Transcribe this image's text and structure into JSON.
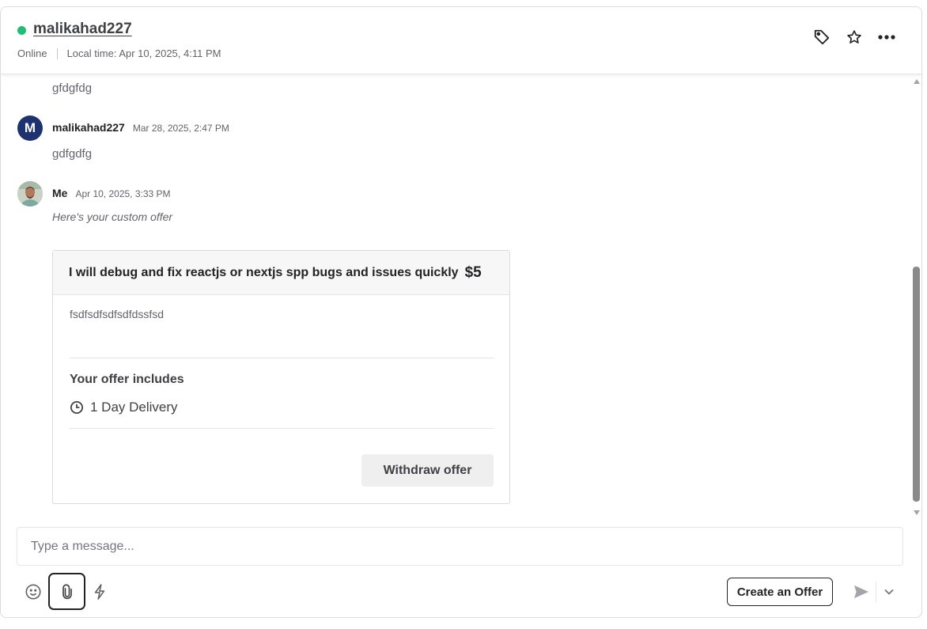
{
  "header": {
    "username": "malikahad227",
    "status": "Online",
    "local_time": "Local time: Apr 10, 2025, 4:11 PM",
    "icons": [
      "tag-icon",
      "star-icon",
      "more-icon"
    ]
  },
  "messages": [
    {
      "text": "gfdgfdg"
    },
    {
      "sender": "malikahad227",
      "avatar_letter": "M",
      "time": "Mar 28, 2025, 2:47 PM",
      "text": "gdfgdfg"
    },
    {
      "sender": "Me",
      "time": "Apr 10, 2025, 3:33 PM",
      "text": "Here's your custom offer"
    }
  ],
  "offer": {
    "title": "I will debug and fix reactjs or nextjs spp bugs and issues quickly",
    "price": "$5",
    "description": "fsdfsdfsdfsdfdssfsd",
    "includes_label": "Your offer includes",
    "delivery": "1 Day Delivery",
    "withdraw_label": "Withdraw offer"
  },
  "composer": {
    "placeholder": "Type a message...",
    "create_offer_label": "Create an Offer"
  },
  "colors": {
    "online": "#1dbf73",
    "avatar_m": "#1e3270"
  }
}
